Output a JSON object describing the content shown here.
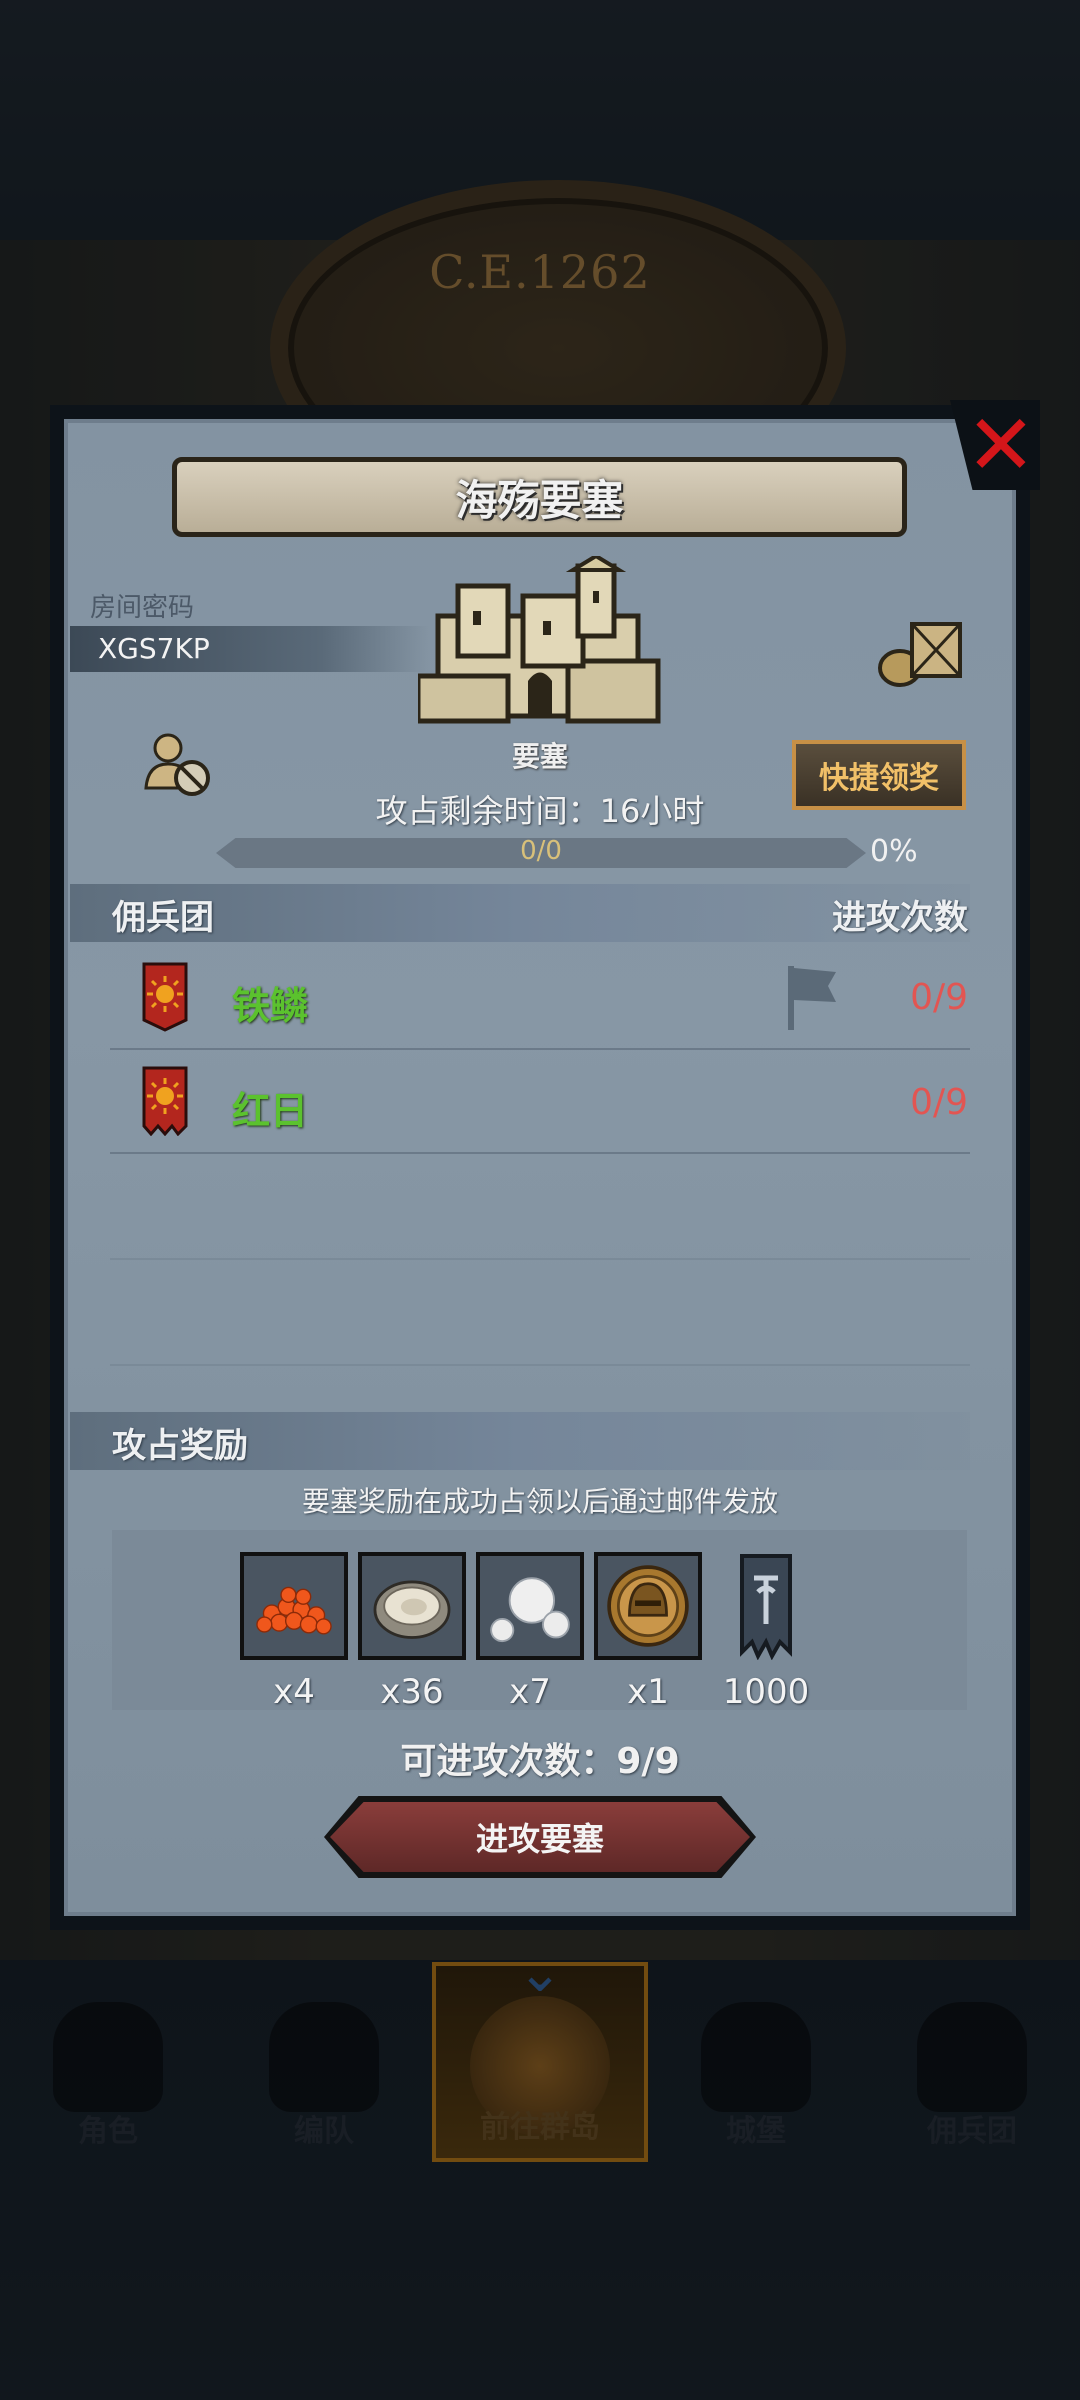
{
  "background": {
    "era_year": "C.E.1262"
  },
  "bottom_nav": {
    "items": [
      {
        "label": "角色",
        "icon": "knight-icon"
      },
      {
        "label": "编队",
        "icon": "formation-icon"
      },
      {
        "label": "前往群岛",
        "icon": "islands-icon"
      },
      {
        "label": "城堡",
        "icon": "castle-icon"
      },
      {
        "label": "佣兵团",
        "icon": "mercenary-icon"
      }
    ],
    "active_index": 2
  },
  "dialog": {
    "title": "海殇要塞",
    "close_icon": "close-icon",
    "room": {
      "label": "房间密码",
      "code": "XGS7KP"
    },
    "fortress": {
      "name": "要塞",
      "icon": "fortress-icon"
    },
    "quick_claim_label": "快捷领奖",
    "remaining_time": "攻占剩余时间：16小时",
    "progress": {
      "text": "0/0",
      "percent_text": "0%",
      "fraction": 0
    },
    "mercenaries": {
      "title": "佣兵团",
      "attack_count_header": "进攻次数",
      "rows": [
        {
          "name": "铁鳞",
          "count": "0/9",
          "has_flag": true
        },
        {
          "name": "红日",
          "count": "0/9",
          "has_flag": false
        }
      ]
    },
    "rewards": {
      "title": "攻占奖励",
      "note": "要塞奖励在成功占领以后通过邮件发放",
      "items": [
        {
          "icon": "roe-icon",
          "qty": "x4"
        },
        {
          "icon": "oyster-icon",
          "qty": "x36"
        },
        {
          "icon": "pearl-icon",
          "qty": "x7"
        },
        {
          "icon": "helmet-medal-icon",
          "qty": "x1"
        },
        {
          "icon": "guild-banner-icon",
          "qty": "1000"
        }
      ]
    },
    "attempts": "可进攻次数：9/9",
    "attack_button_label": "进攻要塞"
  },
  "colors": {
    "merc_name": "#5bc22e",
    "count_red": "#e25552",
    "close_red": "#d4161a",
    "quick_claim_text": "#f1c068",
    "attack_button": "#8a3d3b"
  }
}
